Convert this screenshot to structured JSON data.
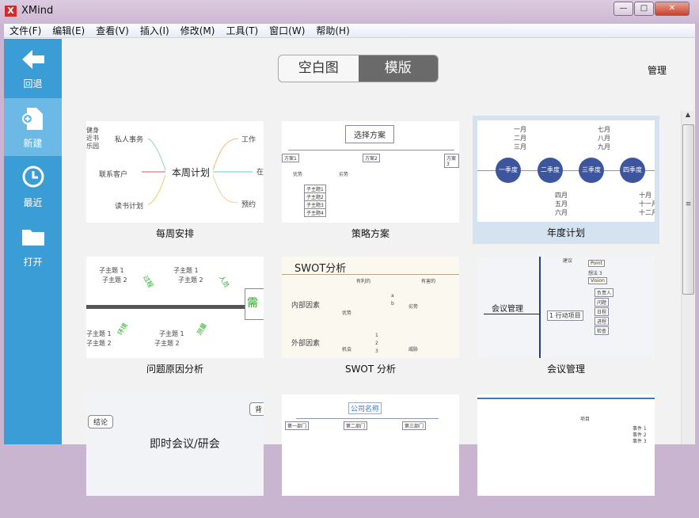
{
  "window": {
    "title": "XMind",
    "logo": "X",
    "controls": [
      "minimize-icon",
      "maximize-icon",
      "close-icon"
    ]
  },
  "menu": [
    "文件(F)",
    "编辑(E)",
    "查看(V)",
    "插入(I)",
    "修改(M)",
    "工具(T)",
    "窗口(W)",
    "帮助(H)"
  ],
  "sidebar": [
    {
      "label": "回退",
      "icon": "back-arrow-icon"
    },
    {
      "label": "新建",
      "icon": "new-file-icon",
      "selected": true
    },
    {
      "label": "最近",
      "icon": "clock-icon"
    },
    {
      "label": "打开",
      "icon": "folder-icon"
    }
  ],
  "tabs": [
    {
      "label": "空白图",
      "active": false
    },
    {
      "label": "模版",
      "active": true
    }
  ],
  "manage": "管理",
  "templates": [
    {
      "label": "每周安排",
      "center": "本周计划",
      "nodes": [
        "私人事务",
        "工作",
        "联系客户",
        "读书计划",
        "预约",
        "健身",
        "近书",
        "乐园",
        "在"
      ]
    },
    {
      "label": "策略方案",
      "center": "选择方案",
      "nodes": [
        "方案1",
        "方案2",
        "方案3",
        "优势",
        "劣势",
        "子主题1",
        "子主题2",
        "子主题3",
        "子主题4"
      ]
    },
    {
      "label": "年度计划",
      "selected": true,
      "quarters": [
        "一季度",
        "二季度",
        "三季度",
        "四季度"
      ],
      "months": [
        [
          "一月",
          "二月",
          "三月"
        ],
        [
          "四月",
          "五月",
          "六月"
        ],
        [
          "七月",
          "八月",
          "九月"
        ],
        [
          "十月",
          "十一月",
          "十二月"
        ]
      ]
    },
    {
      "label": "问题原因分析",
      "nodes": [
        "子主题 1",
        "子主题 2",
        "过程",
        "人员",
        "需",
        "环境",
        "测量"
      ]
    },
    {
      "label": "SWOT 分析",
      "center": "SWOT分析",
      "nodes": [
        "内部因素",
        "外部因素",
        "有利的",
        "有害的",
        "优势",
        "劣势",
        "机会",
        "威胁",
        "a",
        "b",
        "1",
        "2",
        "3"
      ]
    },
    {
      "label": "会议管理",
      "center": "会议管理",
      "nodes": [
        "建议",
        "想法 3",
        "Vision",
        "Point",
        "1 行动项目",
        "负责人",
        "问题",
        "日程",
        "进程",
        "检查"
      ]
    },
    {
      "label": "",
      "center": "即时会议/研会",
      "nodes": [
        "结论",
        "背"
      ]
    },
    {
      "label": "",
      "center": "公司名称",
      "nodes": [
        "第一部门",
        "第二部门",
        "第三部门"
      ]
    },
    {
      "label": "",
      "nodes": [
        "项目",
        "事件 1",
        "事件 2",
        "事件 3"
      ]
    }
  ]
}
